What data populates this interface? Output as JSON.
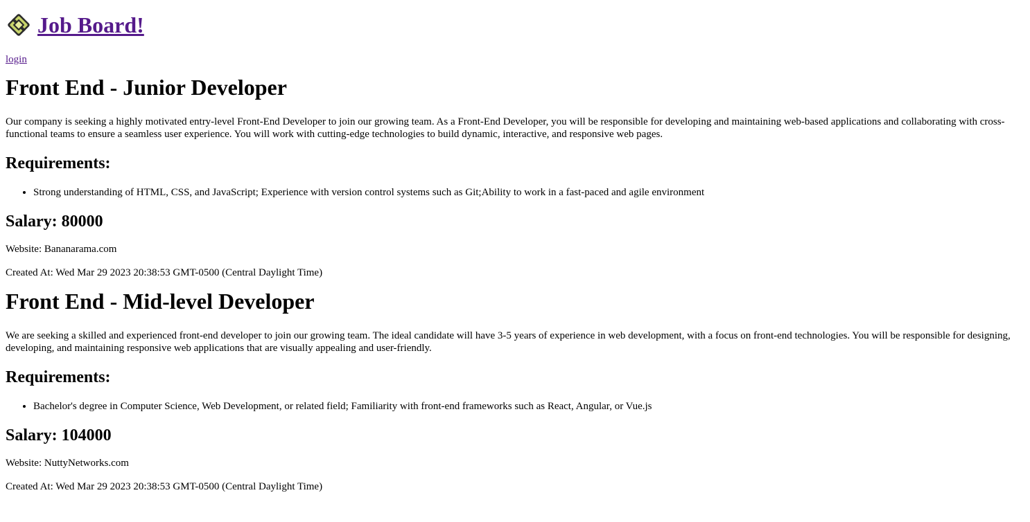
{
  "site": {
    "title": "Job Board!",
    "logo_icon": "diamond-logo-icon",
    "login_label": "login"
  },
  "jobs": [
    {
      "title": "Front End - Junior Developer",
      "description": "Our company is seeking a highly motivated entry-level Front-End Developer to join our growing team. As a Front-End Developer, you will be responsible for developing and maintaining web-based applications and collaborating with cross-functional teams to ensure a seamless user experience. You will work with cutting-edge technologies to build dynamic, interactive, and responsive web pages.",
      "requirements_heading": "Requirements:",
      "requirements": "Strong understanding of HTML, CSS, and JavaScript; Experience with version control systems such as Git;Ability to work in a fast-paced and agile environment",
      "salary": "Salary: 80000",
      "website": "Website: Bananarama.com",
      "created_at": "Created At: Wed Mar 29 2023 20:38:53 GMT-0500 (Central Daylight Time)"
    },
    {
      "title": "Front End - Mid-level Developer",
      "description": "We are seeking a skilled and experienced front-end developer to join our growing team. The ideal candidate will have 3-5 years of experience in web development, with a focus on front-end technologies. You will be responsible for designing, developing, and maintaining responsive web applications that are visually appealing and user-friendly.",
      "requirements_heading": "Requirements:",
      "requirements": "Bachelor's degree in Computer Science, Web Development, or related field; Familiarity with front-end frameworks such as React, Angular, or Vue.js",
      "salary": "Salary: 104000",
      "website": "Website: NuttyNetworks.com",
      "created_at": "Created At: Wed Mar 29 2023 20:38:53 GMT-0500 (Central Daylight Time)"
    }
  ]
}
